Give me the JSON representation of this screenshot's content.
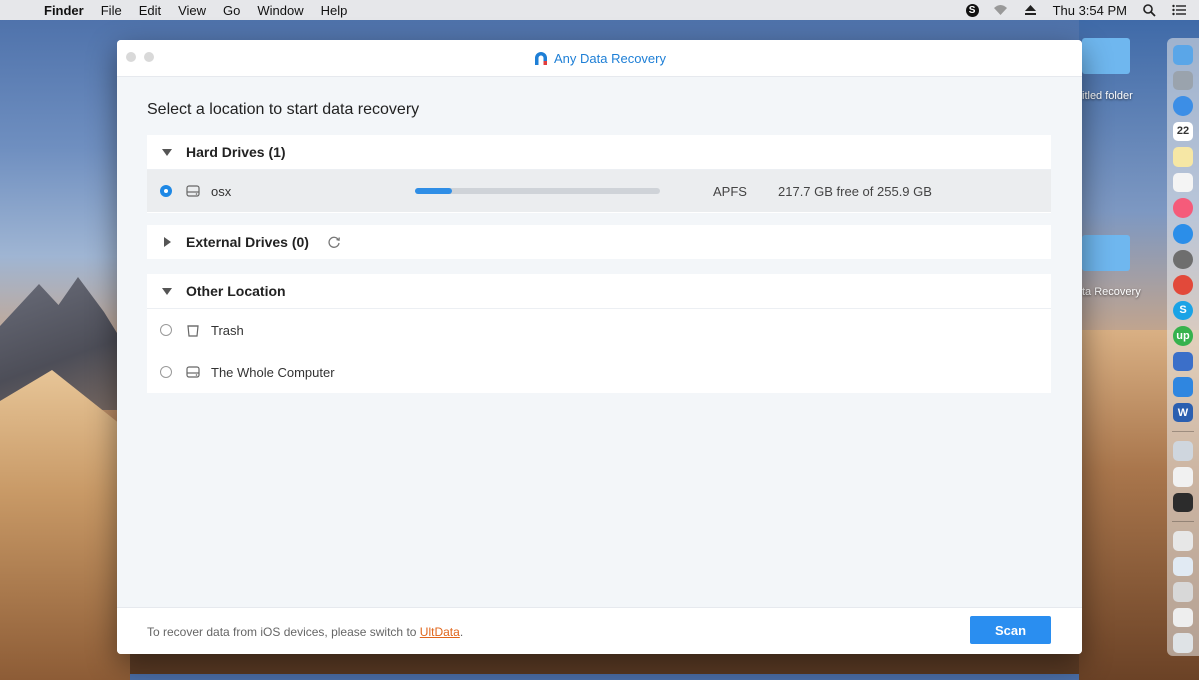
{
  "menubar": {
    "items": [
      "Finder",
      "File",
      "Edit",
      "View",
      "Go",
      "Window",
      "Help"
    ],
    "clock": "Thu 3:54 PM"
  },
  "desktop": {
    "folder1_label": "itled folder",
    "folder2_label": "ta Recovery"
  },
  "window": {
    "title": "Any Data Recovery",
    "heading": "Select a location to start data recovery"
  },
  "hard_drives": {
    "label": "Hard Drives (1)",
    "drives": [
      {
        "name": "osx",
        "filesystem": "APFS",
        "free_text": "217.7 GB free of 255.9 GB",
        "used_fraction": 0.15,
        "selected": true
      }
    ]
  },
  "external_drives": {
    "label": "External Drives (0)"
  },
  "other_location": {
    "label": "Other Location",
    "items": [
      {
        "name": "Trash",
        "icon": "trash-icon"
      },
      {
        "name": "The Whole Computer",
        "icon": "drive-icon"
      }
    ]
  },
  "footer": {
    "text_prefix": "To recover data from iOS devices, please switch to ",
    "link": "UltData",
    "text_suffix": ".",
    "scan_label": "Scan"
  },
  "colors": {
    "accent": "#2a8ef0",
    "link": "#e0651a"
  }
}
